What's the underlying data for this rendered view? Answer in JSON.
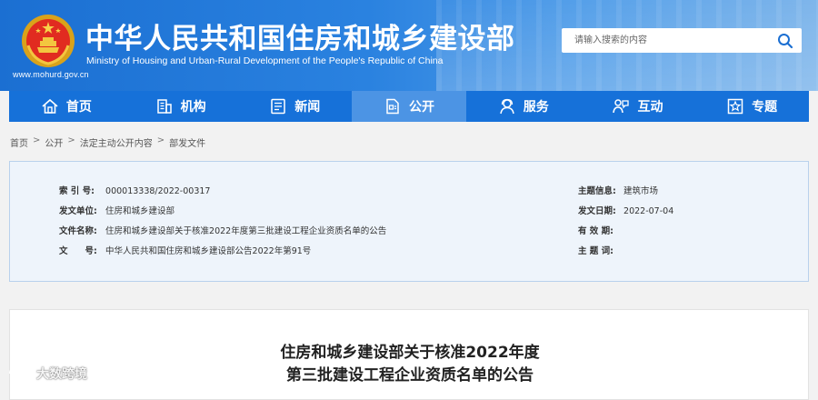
{
  "header": {
    "title": "中华人民共和国住房和城乡建设部",
    "subtitle": "Ministry of Housing and Urban-Rural Development of the People's Republic of China",
    "domain": "www.mohurd.gov.cn",
    "search_placeholder": "请输入搜索的内容",
    "emblem_icon": "national-emblem-icon",
    "search_icon": "search-icon"
  },
  "nav": {
    "items": [
      {
        "label": "首页",
        "icon": "home-icon"
      },
      {
        "label": "机构",
        "icon": "building-icon"
      },
      {
        "label": "新闻",
        "icon": "news-icon"
      },
      {
        "label": "公开",
        "icon": "document-icon",
        "active": true
      },
      {
        "label": "服务",
        "icon": "service-icon"
      },
      {
        "label": "互动",
        "icon": "interaction-icon"
      },
      {
        "label": "专题",
        "icon": "topic-icon"
      }
    ]
  },
  "breadcrumb": [
    "首页",
    "公开",
    "法定主动公开内容",
    "部发文件"
  ],
  "breadcrumb_separator": ">",
  "info": {
    "left": [
      {
        "label": "索 引 号:",
        "value": "000013338/2022-00317"
      },
      {
        "label": "发文单位:",
        "value": "住房和城乡建设部"
      },
      {
        "label": "文件名称:",
        "value": "住房和城乡建设部关于核准2022年度第三批建设工程企业资质名单的公告"
      },
      {
        "label": "文　　号:",
        "value": "中华人民共和国住房和城乡建设部公告2022年第91号"
      }
    ],
    "right": [
      {
        "label": "主题信息:",
        "value": "建筑市场"
      },
      {
        "label": "发文日期:",
        "value": "2022-07-04"
      },
      {
        "label": "有 效 期:",
        "value": ""
      },
      {
        "label": "主 题 词:",
        "value": ""
      }
    ]
  },
  "article": {
    "title_line1": "住房和城乡建设部关于核准2022年度",
    "title_line2": "第三批建设工程企业资质名单的公告"
  },
  "watermark": {
    "text": "大数跨境"
  },
  "colors": {
    "header_blue": "#1b6fd2",
    "nav_blue": "#1671d9",
    "nav_active": "#4c94e4",
    "infobox_bg": "#eef4fb",
    "infobox_border": "#b9d1ec"
  }
}
